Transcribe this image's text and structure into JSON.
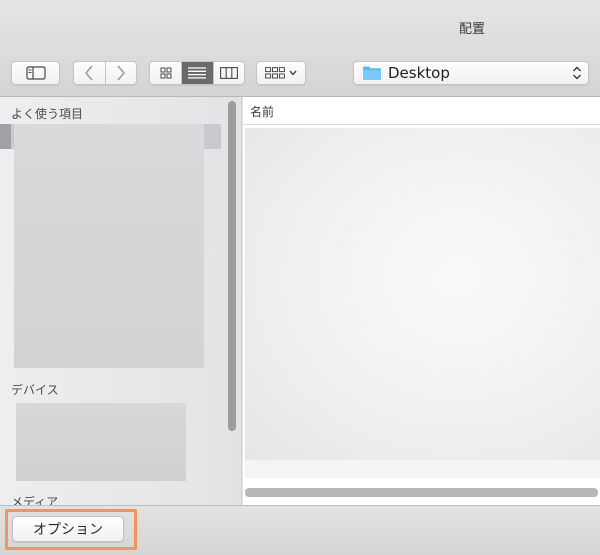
{
  "window": {
    "title": "配置"
  },
  "toolbar": {
    "location": "Desktop",
    "icons": {
      "sidebar_toggle": "sidebar-icon",
      "back": "chevron-left-icon",
      "forward": "chevron-right-icon",
      "icon_view": "grid-view-icon",
      "list_view": "list-view-icon",
      "column_view": "column-view-icon",
      "arrange": "arrange-icon",
      "folder": "folder-icon",
      "popup": "up-down-chevron-icon"
    },
    "active_view": "list",
    "accent": "#5bb8f0"
  },
  "sidebar": {
    "favorites_heading": "よく使う項目",
    "devices_heading": "デバイス",
    "media_heading": "メディア"
  },
  "filelist": {
    "columns": [
      "名前"
    ]
  },
  "bottombar": {
    "options_label": "オプション",
    "highlight_color": "#f4935c"
  }
}
